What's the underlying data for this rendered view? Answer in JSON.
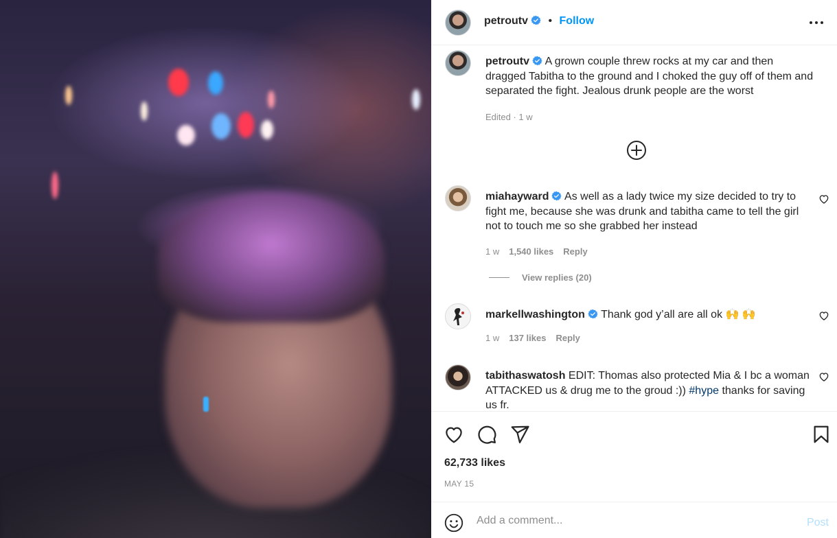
{
  "post": {
    "author": "petroutv",
    "follow_label": "Follow",
    "separator": "•",
    "caption": "A grown couple threw rocks at my car and then dragged Tabitha to the ground and I choked the guy off of them and separated the fight. Jealous drunk people are the worst",
    "caption_meta": "Edited · 1 w"
  },
  "comments": [
    {
      "username": "miahayward",
      "verified": true,
      "text": "As well as a lady twice my size decided to try to fight me, because she was drunk and tabitha came to tell the girl not to touch me so she grabbed her instead",
      "time": "1 w",
      "likes": "1,540 likes",
      "reply": "Reply",
      "view_replies": "View replies (20)"
    },
    {
      "username": "markellwashington",
      "verified": true,
      "text": "Thank god y’all are all ok 🙌 🙌",
      "time": "1 w",
      "likes": "137 likes",
      "reply": "Reply"
    },
    {
      "username": "tabithaswatosh",
      "verified": false,
      "text_before": "EDIT: Thomas also protected Mia & I bc a woman ATTACKED us & drug me to the groud :)) ",
      "hashtag": "#hype",
      "text_after": " thanks for saving us fr."
    }
  ],
  "footer": {
    "likes": "62,733 likes",
    "date": "MAY 15"
  },
  "add_comment": {
    "placeholder": "Add a comment...",
    "post_label": "Post"
  },
  "colors": {
    "accent": "#0095f6",
    "verified": "#3897f0",
    "muted": "#8e8e8e",
    "post_disabled": "#b2dffc"
  },
  "icons": [
    "more-options-icon",
    "verified-icon",
    "load-more-comments-icon",
    "heart-icon",
    "comment-icon",
    "share-icon",
    "bookmark-icon",
    "emoji-icon"
  ]
}
